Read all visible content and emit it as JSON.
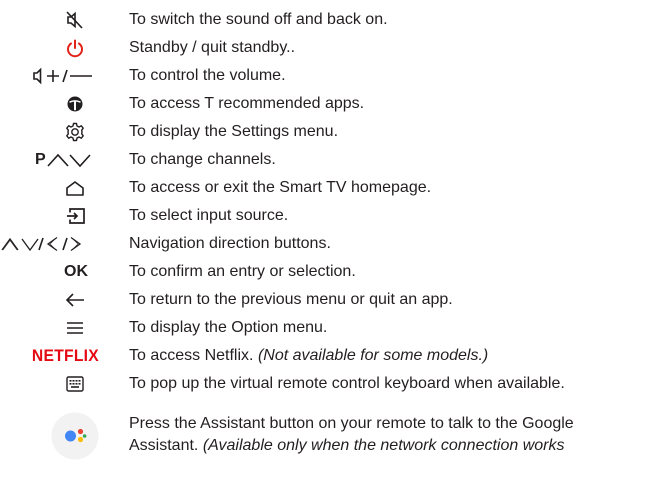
{
  "colors": {
    "text": "#231f20",
    "power_red": "#e2231a",
    "netflix_red": "#e50914",
    "assistant_blue": "#4285f4",
    "assistant_red": "#ea4335",
    "assistant_yellow": "#fbbc05",
    "assistant_green": "#34a853"
  },
  "rows": [
    {
      "icon": "mute-icon",
      "text": "To switch the sound off and back on."
    },
    {
      "icon": "power-icon",
      "text": "Standby / quit standby.."
    },
    {
      "icon": "volume-icon",
      "text": "To control the volume."
    },
    {
      "icon": "t-logo-icon",
      "text": "To access T recommended apps."
    },
    {
      "icon": "settings-gear-icon",
      "text": "To display the Settings menu."
    },
    {
      "icon": "channel-icon",
      "icon_label": "P",
      "text": "To change channels."
    },
    {
      "icon": "home-icon",
      "text": "To access or exit the Smart TV homepage."
    },
    {
      "icon": "input-source-icon",
      "text": "To select input source."
    },
    {
      "icon": "navigation-arrows-icon",
      "text": "Navigation direction buttons."
    },
    {
      "icon": "ok-label",
      "icon_label": "OK",
      "text": "To confirm an entry or selection."
    },
    {
      "icon": "back-arrow-icon",
      "text": "To return to the previous menu or quit an app."
    },
    {
      "icon": "option-menu-icon",
      "text": "To display the Option menu."
    },
    {
      "icon": "netflix-logo",
      "icon_label": "NETFLIX",
      "text": "To access Netflix.",
      "note": "(Not available for some models.)"
    },
    {
      "icon": "keyboard-icon",
      "text": "To pop up the virtual remote control keyboard when available."
    },
    {
      "icon": "google-assistant-icon",
      "text": "Press the Assistant button on your remote to talk to the Google",
      "text2": "Assistant.",
      "note2": "(Available only when the network connection works"
    }
  ]
}
